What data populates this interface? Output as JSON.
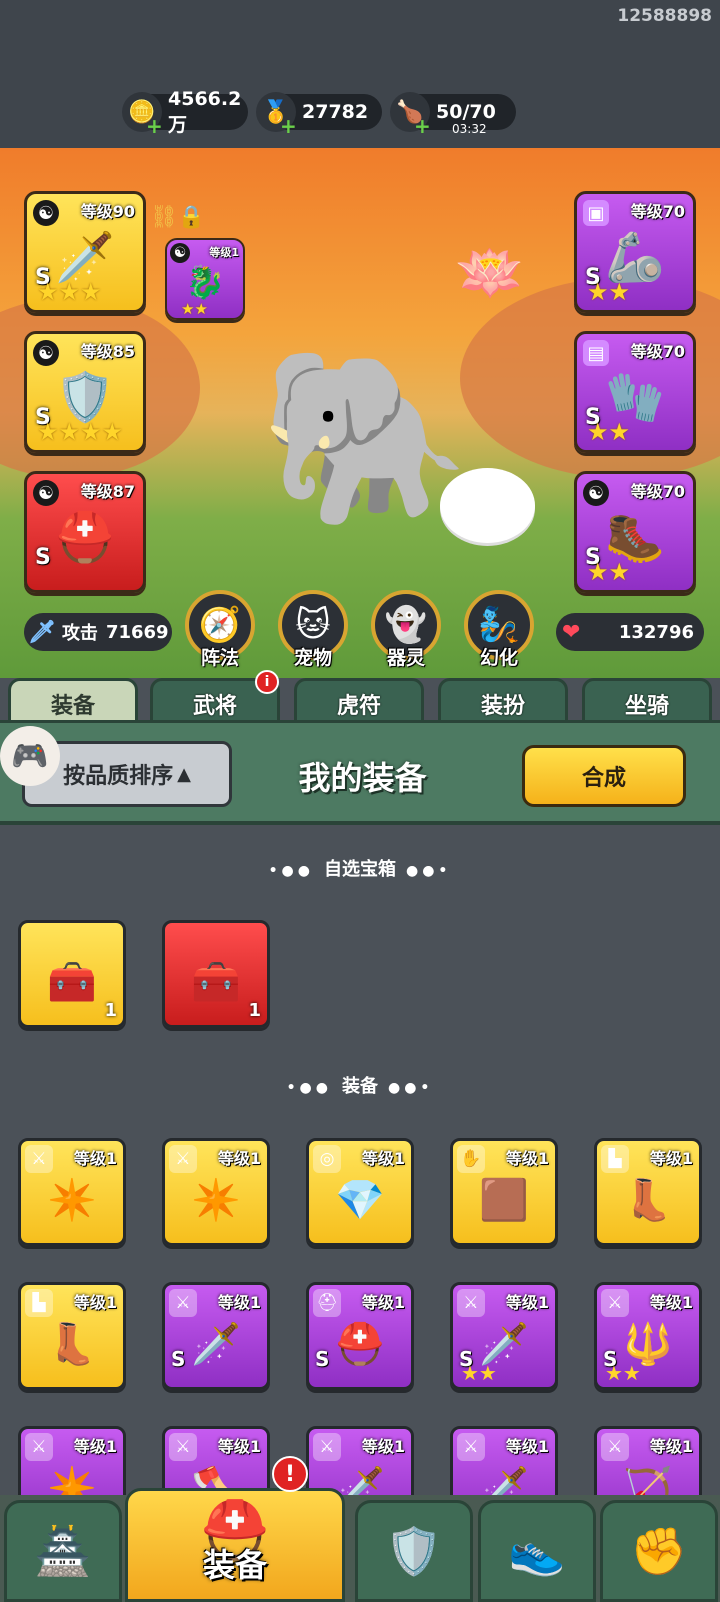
{
  "status": {
    "id_text": "12588898"
  },
  "resources": {
    "silver": {
      "value": "4566.2万",
      "icon": "silver-coin-icon"
    },
    "gold": {
      "value": "27782",
      "icon": "gold-ingot-icon"
    },
    "stamina": {
      "value": "50/70",
      "timer": "03:32",
      "icon": "drumstick-icon"
    }
  },
  "equip_slots": {
    "left": [
      {
        "level": "等级90",
        "quality": "gold",
        "grade": "S",
        "stars": "★★★",
        "icon": "ice-sword-icon",
        "art": "🗡️"
      },
      {
        "level": "等级85",
        "quality": "gold",
        "grade": "S",
        "stars": "★★★★",
        "icon": "ice-armor-icon",
        "art": "🛡️"
      },
      {
        "level": "等级87",
        "quality": "red",
        "grade": "S",
        "stars": "",
        "icon": "ice-helmet-icon",
        "art": "⛑️"
      }
    ],
    "right": [
      {
        "level": "等级70",
        "quality": "purple",
        "grade": "S",
        "stars": "★★",
        "icon": "armor-icon",
        "art": "🦾"
      },
      {
        "level": "等级70",
        "quality": "purple",
        "grade": "S",
        "stars": "★★",
        "icon": "gauntlet-icon",
        "art": "🧤"
      },
      {
        "level": "等级70",
        "quality": "purple",
        "grade": "S",
        "stars": "★★",
        "icon": "boots-icon",
        "art": "🥾"
      }
    ],
    "pet_slot": {
      "level": "等级1",
      "stars": "★★",
      "icon": "dragon-pet-icon"
    }
  },
  "stats": {
    "attack_label": "攻击",
    "attack_value": "71669",
    "hp_value": "132796"
  },
  "features": [
    {
      "label": "阵法",
      "icon": "formation-icon",
      "art": "🧭"
    },
    {
      "label": "宠物",
      "icon": "pet-cat-icon",
      "art": "🐱"
    },
    {
      "label": "器灵",
      "icon": "spirit-icon",
      "art": "👻"
    },
    {
      "label": "幻化",
      "icon": "transform-icon",
      "art": "🧞"
    }
  ],
  "tabs": [
    {
      "label": "装备",
      "active": true
    },
    {
      "label": "武将",
      "active": false,
      "badge": "i"
    },
    {
      "label": "虎符",
      "active": false
    },
    {
      "label": "装扮",
      "active": false
    },
    {
      "label": "坐骑",
      "active": false
    }
  ],
  "panel": {
    "sort_label": "按品质排序",
    "title": "我的装备",
    "synthesize_label": "合成"
  },
  "sections": {
    "chest_title": "自选宝箱",
    "equip_title": "装备"
  },
  "chests": [
    {
      "quality": "gold",
      "count": "1",
      "icon": "chest-icon"
    },
    {
      "quality": "red",
      "count": "1",
      "icon": "chest-icon"
    }
  ],
  "items": [
    {
      "level": "等级1",
      "quality": "gold",
      "type": "sword",
      "icon": "shuriken-icon",
      "art": "✴️",
      "grade": "",
      "stars": ""
    },
    {
      "level": "等级1",
      "quality": "gold",
      "type": "sword",
      "icon": "shuriken-icon",
      "art": "✴️",
      "grade": "",
      "stars": ""
    },
    {
      "level": "等级1",
      "quality": "gold",
      "type": "medal",
      "icon": "amulet-icon",
      "art": "💎",
      "grade": "",
      "stars": ""
    },
    {
      "level": "等级1",
      "quality": "gold",
      "type": "glove",
      "icon": "bracer-icon",
      "art": "🟫",
      "grade": "",
      "stars": ""
    },
    {
      "level": "等级1",
      "quality": "gold",
      "type": "boot",
      "icon": "boots-icon",
      "art": "👢",
      "grade": "",
      "stars": ""
    },
    {
      "level": "等级1",
      "quality": "gold",
      "type": "boot",
      "icon": "boots-icon",
      "art": "👢",
      "grade": "",
      "stars": ""
    },
    {
      "level": "等级1",
      "quality": "purple",
      "type": "sword",
      "icon": "dagger-icon",
      "art": "🗡️",
      "grade": "S",
      "stars": ""
    },
    {
      "level": "等级1",
      "quality": "purple",
      "type": "helmet",
      "icon": "helmet-icon",
      "art": "⛑️",
      "grade": "S",
      "stars": ""
    },
    {
      "level": "等级1",
      "quality": "purple",
      "type": "sword",
      "icon": "ice-sword-icon",
      "art": "🗡️",
      "grade": "S",
      "stars": "★★"
    },
    {
      "level": "等级1",
      "quality": "purple",
      "type": "sword",
      "icon": "spear-icon",
      "art": "🔱",
      "grade": "S",
      "stars": "★★"
    },
    {
      "level": "等级1",
      "quality": "purple",
      "type": "sword",
      "icon": "shuriken-icon",
      "art": "✴️",
      "grade": "",
      "stars": ""
    },
    {
      "level": "等级1",
      "quality": "purple",
      "type": "sword",
      "icon": "axe-icon",
      "art": "🪓",
      "grade": "",
      "stars": ""
    },
    {
      "level": "等级1",
      "quality": "purple",
      "type": "sword",
      "icon": "dagger-icon",
      "art": "🗡️",
      "grade": "",
      "stars": ""
    },
    {
      "level": "等级1",
      "quality": "purple",
      "type": "sword",
      "icon": "dagger-icon",
      "art": "🗡️",
      "grade": "",
      "stars": ""
    },
    {
      "level": "等级1",
      "quality": "purple",
      "type": "sword",
      "icon": "bow-icon",
      "art": "🏹",
      "grade": "",
      "stars": ""
    }
  ],
  "bottom_nav": [
    {
      "label": "",
      "icon": "city-gate-icon",
      "art": "🏯"
    },
    {
      "label": "装备",
      "icon": "helmet-icon",
      "art": "⛑️",
      "active": true,
      "badge": "!"
    },
    {
      "label": "",
      "icon": "crest-icon",
      "art": "🛡️"
    },
    {
      "label": "",
      "icon": "shoe-icon",
      "art": "👟"
    },
    {
      "label": "",
      "icon": "fist-upgrade-icon",
      "art": "✊"
    }
  ],
  "colors": {
    "gold": "#f6bf1d",
    "purple": "#9b3ad2",
    "red": "#d42424",
    "panel_green": "#4d7a62"
  }
}
